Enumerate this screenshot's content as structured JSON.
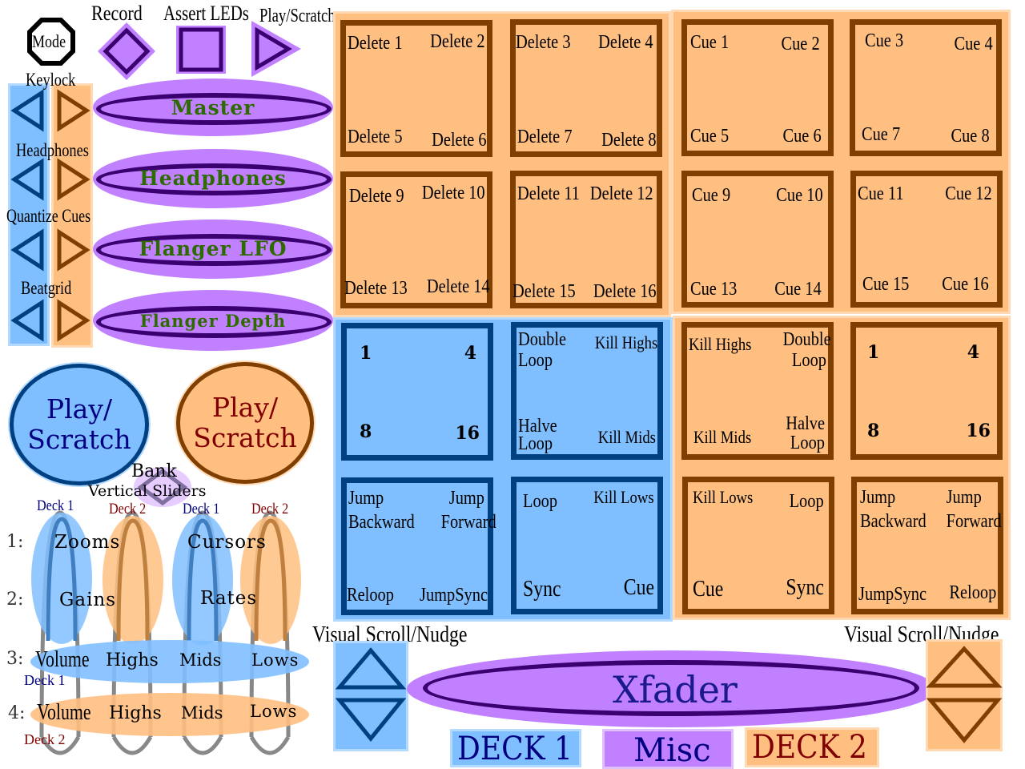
{
  "colors": {
    "deck1_fill": "#80bfff",
    "deck1_stroke": "#004080",
    "deck1_text": "#000080",
    "deck2_fill": "#ffbf80",
    "deck2_stroke": "#7f3f00",
    "deck2_text": "#800000",
    "misc_fill": "#c080ff",
    "misc_stroke": "#3b0070",
    "knob_text": "#2d6b00"
  },
  "top_buttons": {
    "mode": "Mode",
    "record": "Record",
    "assert_leds": "Assert LEDs",
    "play_scratch": "Play/Scratch"
  },
  "side_buttons": [
    {
      "label": "Keylock"
    },
    {
      "label": "Headphones"
    },
    {
      "label": "Quantize Cues"
    },
    {
      "label": "Beatgrid"
    }
  ],
  "knobs": [
    "Master",
    "Headphones",
    "Flanger LFO",
    "Flanger Depth"
  ],
  "play_scratch": {
    "deck1": [
      "Play/",
      "Scratch"
    ],
    "deck2": [
      "Play/",
      "Scratch"
    ]
  },
  "bank": {
    "title": "Bank",
    "subtitle": "Vertical Sliders"
  },
  "sliders": {
    "deck_labels": [
      "Deck 1",
      "Deck 2",
      "Deck 1",
      "Deck 2"
    ],
    "rows": [
      {
        "num": "1:",
        "left": "Zooms",
        "right": "Cursors"
      },
      {
        "num": "2:",
        "left": "Gains",
        "right": "Rates"
      }
    ],
    "eq_rows": [
      {
        "num": "3:",
        "deck": "Deck 1",
        "items": [
          "Volume",
          "Highs",
          "Mids",
          "Lows"
        ]
      },
      {
        "num": "4:",
        "deck": "Deck 2",
        "items": [
          "Volume",
          "Highs",
          "Mids",
          "Lows"
        ]
      }
    ]
  },
  "delete_pads": [
    [
      "Delete 1",
      "Delete 2",
      "Delete 5",
      "Delete 6"
    ],
    [
      "Delete 3",
      "Delete 4",
      "Delete 7",
      "Delete 8"
    ],
    [
      "Delete 9",
      "Delete 10",
      "Delete 13",
      "Delete 14"
    ],
    [
      "Delete 11",
      "Delete 12",
      "Delete 15",
      "Delete 16"
    ]
  ],
  "cue_pads": [
    [
      "Cue 1",
      "Cue 2",
      "Cue 5",
      "Cue 6"
    ],
    [
      "Cue 3",
      "Cue 4",
      "Cue 7",
      "Cue 8"
    ],
    [
      "Cue 9",
      "Cue 10",
      "Cue 13",
      "Cue 14"
    ],
    [
      "Cue 11",
      "Cue 12",
      "Cue 15",
      "Cue 16"
    ]
  ],
  "deck1_pads": {
    "loop_sizes": [
      "1",
      "4",
      "8",
      "16"
    ],
    "loop_kill": {
      "tl": "Double Loop",
      "tr": "Kill Highs",
      "bl": "Halve Loop",
      "br": "Kill Mids"
    },
    "jump": {
      "tl": "Jump Backward",
      "tr": "Jump Forward",
      "bl": "Reloop",
      "br": "JumpSync"
    },
    "transport": {
      "tl": "Loop",
      "tr": "Kill Lows",
      "bl": "Sync",
      "br": "Cue"
    }
  },
  "deck2_pads": {
    "loop_kill": {
      "tl": "Kill Highs",
      "tr": "Double Loop",
      "bl": "Kill Mids",
      "br": "Halve Loop"
    },
    "loop_sizes": [
      "1",
      "4",
      "8",
      "16"
    ],
    "transport": {
      "tl": "Kill Lows",
      "tr": "Loop",
      "bl": "Cue",
      "br": "Sync"
    },
    "jump": {
      "tl": "Jump Backward",
      "tr": "Jump Forward",
      "bl": "JumpSync",
      "br": "Reloop"
    }
  },
  "bottom": {
    "scroll_left": "Visual Scroll/Nudge",
    "scroll_right": "Visual Scroll/Nudge",
    "xfader": "Xfader"
  },
  "legend": {
    "deck1": "DECK 1",
    "misc": "Misc",
    "deck2": "DECK 2"
  }
}
